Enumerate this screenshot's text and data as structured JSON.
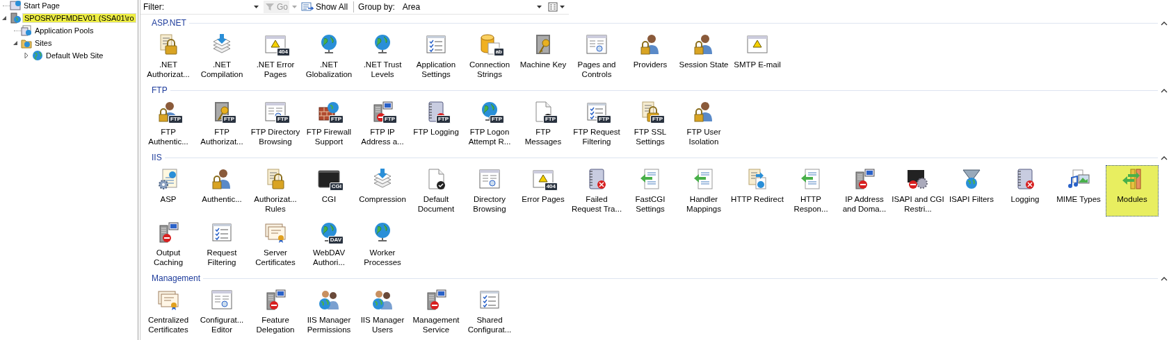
{
  "tree": [
    {
      "label": "Start Page",
      "kind": "start",
      "selected": false
    },
    {
      "label": "SPOSRVPFMDEV01 (SSA01\\ro",
      "kind": "server",
      "selected": true,
      "expanded": true,
      "children": [
        {
          "label": "Application Pools",
          "kind": "pools",
          "selected": false
        },
        {
          "label": "Sites",
          "kind": "sites",
          "selected": false,
          "expanded": true,
          "children": [
            {
              "label": "Default Web Site",
              "kind": "site",
              "selected": false,
              "expanded": false
            }
          ]
        }
      ]
    }
  ],
  "toolbar": {
    "filter_label": "Filter:",
    "go": {
      "label": "Go",
      "disabled": true
    },
    "show_all": "Show All",
    "group_by_label": "Group by:",
    "group_by_value": "Area"
  },
  "groups": [
    {
      "title": "ASP.NET",
      "expanded": true,
      "items": [
        {
          "label": ".NET Authorizat...",
          "selected": false
        },
        {
          "label": ".NET Compilation",
          "selected": false
        },
        {
          "label": ".NET Error Pages",
          "selected": false,
          "badge": "404"
        },
        {
          "label": ".NET Globalization",
          "selected": false
        },
        {
          "label": ".NET Trust Levels",
          "selected": false
        },
        {
          "label": "Application Settings",
          "selected": false
        },
        {
          "label": "Connection Strings",
          "selected": false,
          "badge": "ab"
        },
        {
          "label": "Machine Key",
          "selected": false
        },
        {
          "label": "Pages and Controls",
          "selected": false
        },
        {
          "label": "Providers",
          "selected": false
        },
        {
          "label": "Session State",
          "selected": false
        },
        {
          "label": "SMTP E-mail",
          "selected": false
        }
      ]
    },
    {
      "title": "FTP",
      "expanded": true,
      "items": [
        {
          "label": "FTP Authentic...",
          "selected": false,
          "badge": "FTP"
        },
        {
          "label": "FTP Authorizat...",
          "selected": false,
          "badge": "FTP"
        },
        {
          "label": "FTP Directory Browsing",
          "selected": false,
          "badge": "FTP"
        },
        {
          "label": "FTP Firewall Support",
          "selected": false,
          "badge": "FTP"
        },
        {
          "label": "FTP IP Address a...",
          "selected": false,
          "badge": "FTP"
        },
        {
          "label": "FTP Logging",
          "selected": false,
          "badge": "FTP"
        },
        {
          "label": "FTP Logon Attempt R...",
          "selected": false,
          "badge": "FTP"
        },
        {
          "label": "FTP Messages",
          "selected": false,
          "badge": "FTP"
        },
        {
          "label": "FTP Request Filtering",
          "selected": false,
          "badge": "FTP"
        },
        {
          "label": "FTP SSL Settings",
          "selected": false,
          "badge": "FTP"
        },
        {
          "label": "FTP User Isolation",
          "selected": false
        }
      ]
    },
    {
      "title": "IIS",
      "expanded": true,
      "items": [
        {
          "label": "ASP",
          "selected": false
        },
        {
          "label": "Authentic...",
          "selected": false
        },
        {
          "label": "Authorizat... Rules",
          "selected": false
        },
        {
          "label": "CGI",
          "selected": false,
          "badge": "CGI"
        },
        {
          "label": "Compression",
          "selected": false
        },
        {
          "label": "Default Document",
          "selected": false
        },
        {
          "label": "Directory Browsing",
          "selected": false
        },
        {
          "label": "Error Pages",
          "selected": false,
          "badge": "404"
        },
        {
          "label": "Failed Request Tra...",
          "selected": false
        },
        {
          "label": "FastCGI Settings",
          "selected": false
        },
        {
          "label": "Handler Mappings",
          "selected": false
        },
        {
          "label": "HTTP Redirect",
          "selected": false
        },
        {
          "label": "HTTP Respon...",
          "selected": false
        },
        {
          "label": "IP Address and Doma...",
          "selected": false
        },
        {
          "label": "ISAPI and CGI Restri...",
          "selected": false
        },
        {
          "label": "ISAPI Filters",
          "selected": false
        },
        {
          "label": "Logging",
          "selected": false
        },
        {
          "label": "MIME Types",
          "selected": false
        },
        {
          "label": "Modules",
          "selected": true
        },
        {
          "label": "Output Caching",
          "selected": false
        },
        {
          "label": "Request Filtering",
          "selected": false
        },
        {
          "label": "Server Certificates",
          "selected": false
        },
        {
          "label": "WebDAV Authori...",
          "selected": false,
          "badge": "DAV"
        },
        {
          "label": "Worker Processes",
          "selected": false
        }
      ]
    },
    {
      "title": "Management",
      "expanded": true,
      "items": [
        {
          "label": "Centralized Certificates",
          "selected": false
        },
        {
          "label": "Configurat... Editor",
          "selected": false
        },
        {
          "label": "Feature Delegation",
          "selected": false
        },
        {
          "label": "IIS Manager Permissions",
          "selected": false
        },
        {
          "label": "IIS Manager Users",
          "selected": false
        },
        {
          "label": "Management Service",
          "selected": false
        },
        {
          "label": "Shared Configurat...",
          "selected": false
        }
      ]
    }
  ]
}
